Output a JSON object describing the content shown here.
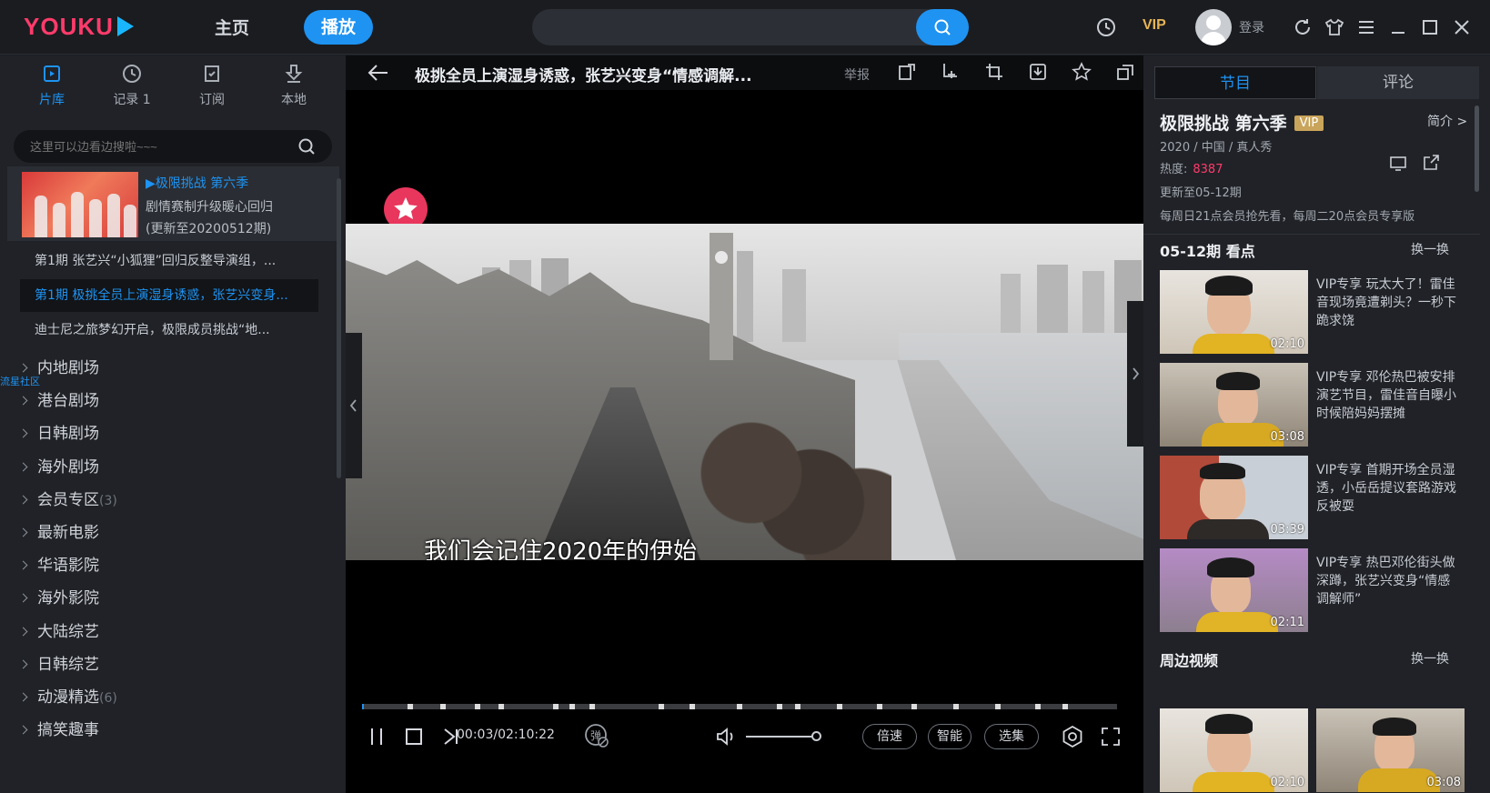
{
  "app": {
    "logo": "YOUKU",
    "nav": {
      "home": "主页",
      "play": "播放"
    },
    "search": {
      "value": "",
      "placeholder": ""
    },
    "vip": "VIP",
    "login": "登录"
  },
  "sidebar": {
    "tabs": [
      {
        "label": "片库",
        "icon": "library-icon",
        "active": true
      },
      {
        "label": "记录 1",
        "icon": "history-icon",
        "active": false
      },
      {
        "label": "订阅",
        "icon": "subscribe-icon",
        "active": false
      },
      {
        "label": "本地",
        "icon": "download-icon",
        "active": false
      }
    ],
    "search_placeholder": "这里可以边看边搜啦~~~",
    "current_show": {
      "title": "▶极限挑战 第六季",
      "subtitle": "剧情赛制升级暖心回归",
      "update": "(更新至20200512期)"
    },
    "episodes": [
      {
        "label": "第1期 张艺兴“小狐狸”回归反整导演组，...",
        "active": false
      },
      {
        "label": "第1期 极挑全员上演湿身诱惑，张艺兴变身...",
        "active": true
      },
      {
        "label": "迪士尼之旅梦幻开启，极限成员挑战“地...",
        "active": false
      }
    ],
    "community": "流星社区",
    "categories": [
      {
        "label": "内地剧场",
        "count": ""
      },
      {
        "label": "港台剧场",
        "count": ""
      },
      {
        "label": "日韩剧场",
        "count": ""
      },
      {
        "label": "海外剧场",
        "count": ""
      },
      {
        "label": "会员专区",
        "count": "(3)"
      },
      {
        "label": "最新电影",
        "count": ""
      },
      {
        "label": "华语影院",
        "count": ""
      },
      {
        "label": "海外影院",
        "count": ""
      },
      {
        "label": "大陆综艺",
        "count": ""
      },
      {
        "label": "日韩综艺",
        "count": ""
      },
      {
        "label": "动漫精选",
        "count": "(6)"
      },
      {
        "label": "搞笑趣事",
        "count": ""
      }
    ]
  },
  "player": {
    "title": "极挑全员上演湿身诱惑，张艺兴变身“情感调解...",
    "report": "举报",
    "subtitle": "我们会记住2020年的伊始",
    "time": "00:03/02:10:22",
    "progress_fraction": 0.0004,
    "volume_fraction": 0.9,
    "buttons": {
      "speed": "倍速",
      "smart": "智能",
      "episodes": "选集"
    }
  },
  "right": {
    "tabs": {
      "program": "节目",
      "comments": "评论"
    },
    "show_title": "极限挑战 第六季",
    "vip_badge": "VIP",
    "intro": "简介",
    "meta": "2020 / 中国 / 真人秀",
    "heat_label": "热度:",
    "heat_value": "8387",
    "update": "更新至05-12期",
    "schedule": "每周日21点会员抢先看，每周二20点会员专享版",
    "highlights_title": "05-12期 看点",
    "refresh": "换一换",
    "clips": [
      {
        "text": "VIP专享 玩太大了！雷佳音现场竟遭剃头？一秒下跪求饶",
        "duration": "02:10"
      },
      {
        "text": "VIP专享 邓伦热巴被安排演艺节目，雷佳音自曝小时候陪妈妈摆摊",
        "duration": "03:08"
      },
      {
        "text": "VIP专享 首期开场全员湿透，小岳岳提议套路游戏反被耍",
        "duration": "03:39"
      },
      {
        "text": "VIP专享 热巴邓伦街头做深蹲，张艺兴变身“情感调解师”",
        "duration": "02:11"
      }
    ],
    "nearby_title": "周边视频",
    "nearby_refresh": "换一换",
    "nearby": [
      {
        "duration": "02:10"
      },
      {
        "duration": "03:08"
      }
    ]
  }
}
